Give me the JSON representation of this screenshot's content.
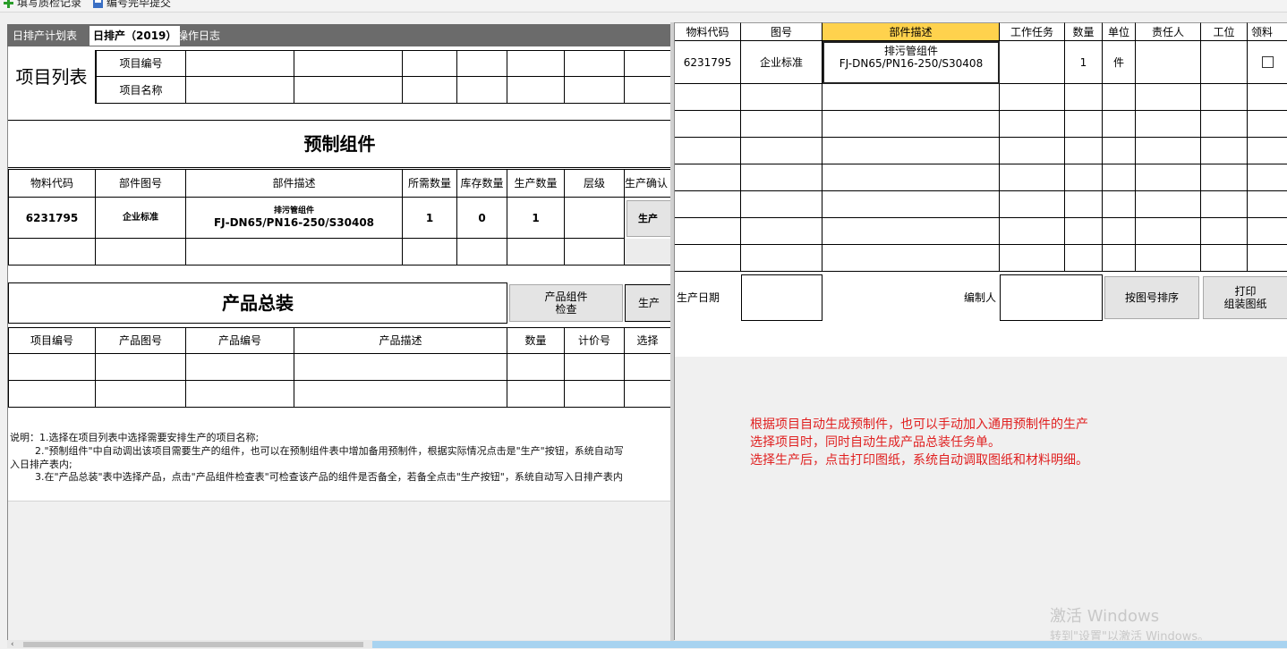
{
  "toolbar": {
    "item1": "填写质检记录",
    "item2": "编号完毕提交"
  },
  "tabs": [
    "日排产计划表",
    "日排产（2019）",
    "操作日志"
  ],
  "project_list": {
    "title": "项目列表",
    "row1_label": "项目编号",
    "row2_label": "项目名称"
  },
  "prefab": {
    "title": "预制组件",
    "headers": [
      "物料代码",
      "部件图号",
      "部件描述",
      "所需数量",
      "库存数量",
      "生产数量",
      "层级",
      "生产确认"
    ],
    "row": {
      "code": "6231795",
      "drawing": "企业标准",
      "desc1": "排污管组件",
      "desc2": "FJ-DN65/PN16-250/S30408",
      "need": "1",
      "stock": "0",
      "produce": "1",
      "level": "",
      "button": "生产"
    }
  },
  "assembly": {
    "title": "产品总装",
    "check_button": "产品组件\n检查",
    "produce_button": "生产",
    "headers": [
      "项目编号",
      "产品图号",
      "产品编号",
      "产品描述",
      "数量",
      "计价号",
      "选择"
    ]
  },
  "notes": {
    "line1": "说明：1.选择在项目列表中选择需要安排生产的项目名称;",
    "line2": "        2.\"预制组件\"中自动调出该项目需要生产的组件，也可以在预制组件表中增加备用预制件，根据实际情况点击是\"生产\"按钮，系统自动写",
    "line3": "入日排产表内;",
    "line4": "        3.在\"产品总装\"表中选择产品，点击\"产品组件检查表\"可检查该产品的组件是否备全，若备全点击\"生产按钮\"，系统自动写入日排产表内"
  },
  "right_table": {
    "headers": [
      "物料代码",
      "图号",
      "部件描述",
      "工作任务",
      "数量",
      "单位",
      "责任人",
      "工位",
      "领料"
    ],
    "row": {
      "code": "6231795",
      "drawing": "企业标准",
      "desc1": "排污管组件",
      "desc2": "FJ-DN65/PN16-250/S30408",
      "task": "",
      "qty": "1",
      "unit": "件"
    }
  },
  "footer": {
    "date_label": "生产日期",
    "editor_label": "编制人",
    "sort_button": "按图号排序",
    "print_button": "打印\n组装图纸"
  },
  "annotation": {
    "line1": "根据项目自动生成预制件，也可以手动加入通用预制件的生产",
    "line2": "选择项目时，同时自动生成产品总装任务单。",
    "line3": "选择生产后，点击打印图纸，系统自动调取图纸和材料明细。"
  },
  "watermark": {
    "line1": "激活 Windows",
    "line2": "转到\"设置\"以激活 Windows。"
  },
  "colors": {
    "tab_bar": "#6b6b6b",
    "header_highlight": "#ffd24d",
    "annotation": "#e02020"
  }
}
